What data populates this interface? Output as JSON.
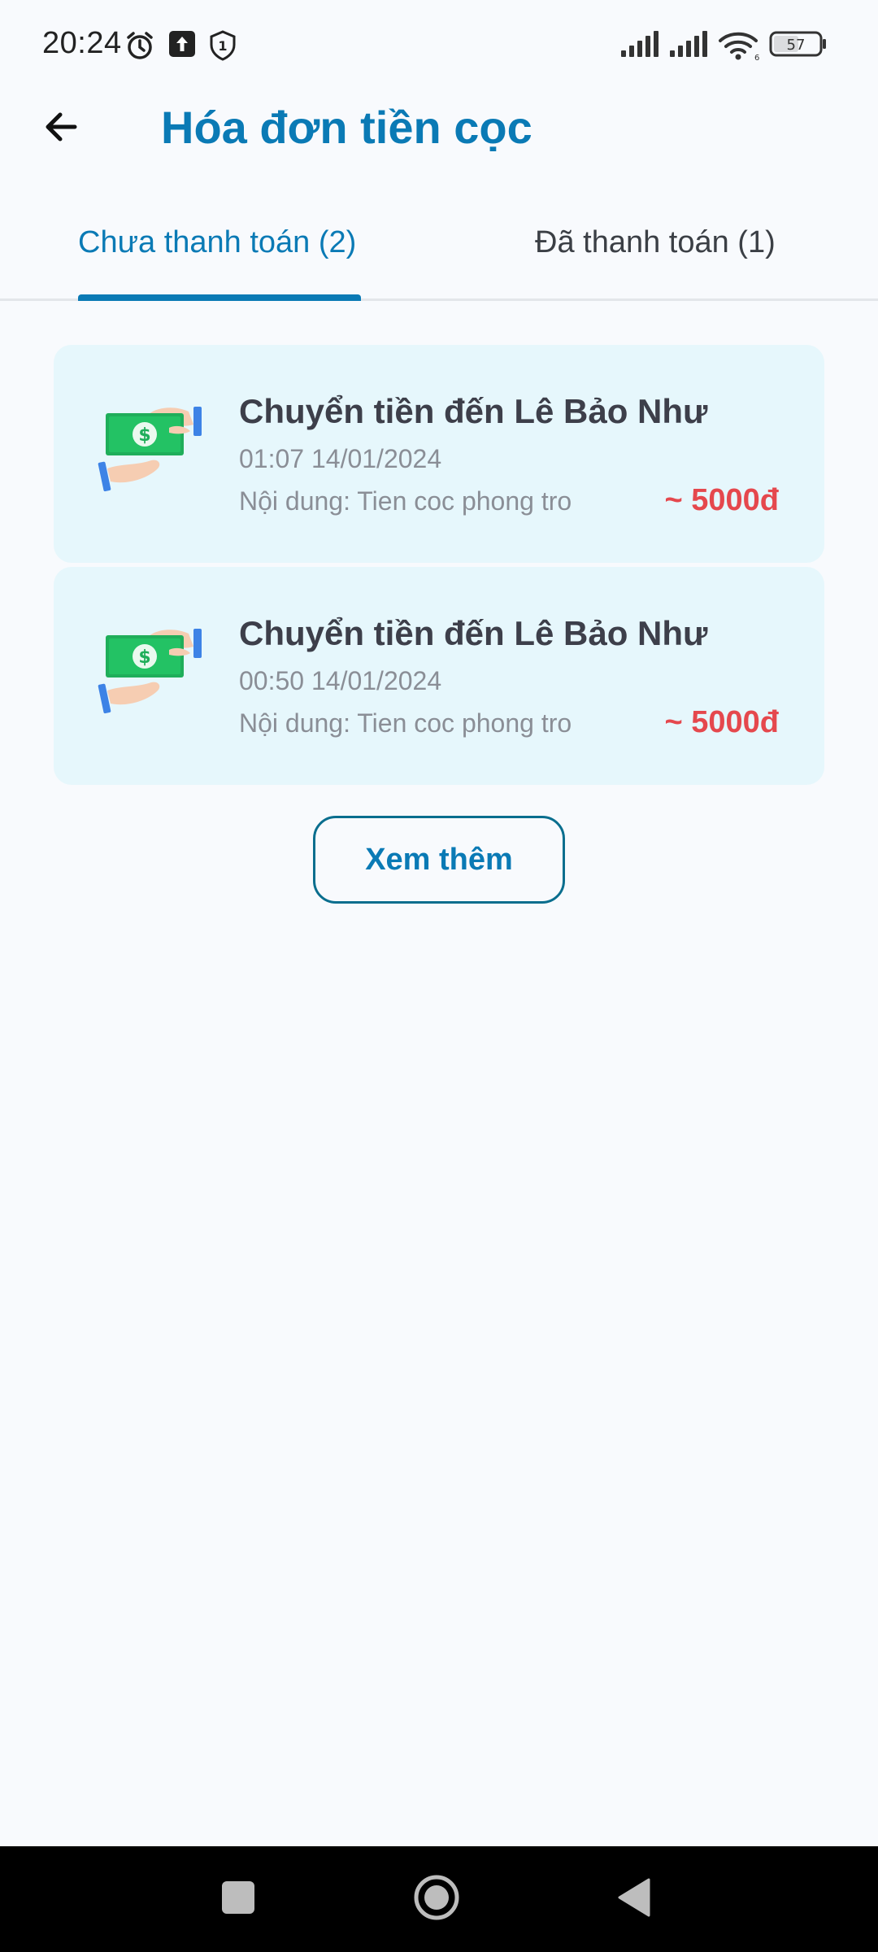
{
  "status_bar": {
    "time": "20:24",
    "battery": "57",
    "icons": [
      "alarm-icon",
      "upload-icon",
      "shield-icon",
      "signal-icon",
      "signal-icon",
      "wifi-icon",
      "battery-icon"
    ]
  },
  "header": {
    "title": "Hóa đơn tiền cọc",
    "back_icon": "arrow-left-icon"
  },
  "tabs": [
    {
      "label": "Chưa thanh toán (2)",
      "active": true
    },
    {
      "label": "Đã thanh toán (1)",
      "active": false
    }
  ],
  "invoices": [
    {
      "title": "Chuyển tiền đến Lê Bảo Như",
      "datetime": "01:07 14/01/2024",
      "content": "Nội dung: Tien coc phong tro",
      "amount": "~ 5000đ",
      "icon": "money-transfer-icon"
    },
    {
      "title": "Chuyển tiền đến Lê Bảo Như",
      "datetime": "00:50 14/01/2024",
      "content": "Nội dung: Tien coc phong tro",
      "amount": "~ 5000đ",
      "icon": "money-transfer-icon"
    }
  ],
  "more_button": {
    "label": "Xem thêm"
  },
  "colors": {
    "primary": "#0A7AB5",
    "amount": "#E5484D",
    "card_bg": "#E6F7FC",
    "page_bg": "#F8FAFD"
  },
  "nav_bar": {
    "icons": [
      "square-icon",
      "circle-home-icon",
      "triangle-back-icon"
    ]
  }
}
